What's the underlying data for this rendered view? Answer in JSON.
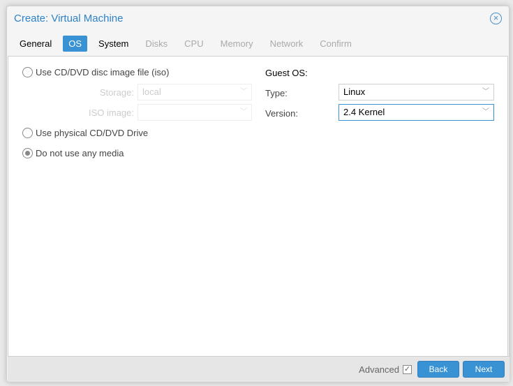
{
  "window": {
    "title": "Create: Virtual Machine"
  },
  "tabs": [
    {
      "label": "General"
    },
    {
      "label": "OS"
    },
    {
      "label": "System"
    },
    {
      "label": "Disks"
    },
    {
      "label": "CPU"
    },
    {
      "label": "Memory"
    },
    {
      "label": "Network"
    },
    {
      "label": "Confirm"
    }
  ],
  "media": {
    "iso_label": "Use CD/DVD disc image file (iso)",
    "storage_label": "Storage:",
    "storage_value": "local",
    "iso_image_label": "ISO image:",
    "iso_image_value": "",
    "physical_label": "Use physical CD/DVD Drive",
    "none_label": "Do not use any media",
    "selected": "none"
  },
  "guest": {
    "heading": "Guest OS:",
    "type_label": "Type:",
    "type_value": "Linux",
    "version_label": "Version:",
    "version_value": "2.4 Kernel"
  },
  "footer": {
    "advanced_label": "Advanced",
    "advanced_checked": true,
    "back": "Back",
    "next": "Next"
  }
}
